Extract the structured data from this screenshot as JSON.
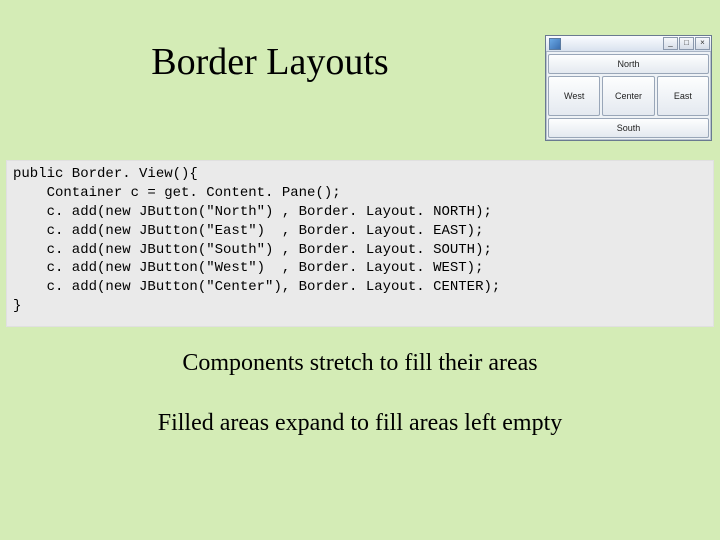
{
  "title": "Border Layouts",
  "mini_window": {
    "buttons": {
      "north": "North",
      "west": "West",
      "center": "Center",
      "east": "East",
      "south": "South"
    },
    "controls": {
      "min": "_",
      "max": "□",
      "close": "×"
    }
  },
  "code": "public Border. View(){\n    Container c = get. Content. Pane();\n    c. add(new JButton(\"North\") , Border. Layout. NORTH);\n    c. add(new JButton(\"East\")  , Border. Layout. EAST);\n    c. add(new JButton(\"South\") , Border. Layout. SOUTH);\n    c. add(new JButton(\"West\")  , Border. Layout. WEST);\n    c. add(new JButton(\"Center\"), Border. Layout. CENTER);\n}",
  "body": {
    "line1": "Components stretch to fill their areas",
    "line2": "Filled areas expand to fill areas left empty"
  }
}
